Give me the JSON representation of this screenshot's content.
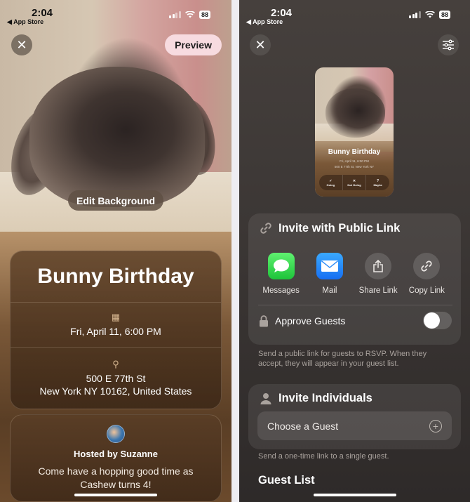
{
  "status_bar": {
    "time": "2:04",
    "back_app": "◀ App Store",
    "battery": "88"
  },
  "editor": {
    "close_icon": "✕",
    "preview_label": "Preview",
    "edit_background_label": "Edit Background",
    "event": {
      "title": "Bunny Birthday",
      "calendar_icon": "▦",
      "date": "Fri, April 11, 6:00 PM",
      "location_icon": "⚲",
      "address_line1": "500 E 77th St",
      "address_line2": "New York NY 10162, United States"
    },
    "host": {
      "hosted_by": "Hosted by Suzanne",
      "description": "Come have a hopping good time as Cashew turns 4!"
    }
  },
  "invite": {
    "close_icon": "✕",
    "settings_icon": "☰",
    "preview_card": {
      "title": "Bunny Birthday",
      "date": "Fri, April 11, 6:00 PM",
      "address": "500 E 77th St, New York NY",
      "rsvp": [
        {
          "icon": "✓",
          "label": "Going"
        },
        {
          "icon": "✕",
          "label": "Not Going"
        },
        {
          "icon": "?",
          "label": "Maybe"
        }
      ]
    },
    "public_link": {
      "title": "Invite with Public Link",
      "link_icon": "🔗",
      "share_options": [
        {
          "label": "Messages",
          "icon": "messages-icon"
        },
        {
          "label": "Mail",
          "icon": "mail-icon"
        },
        {
          "label": "Share Link",
          "icon": "share-icon"
        },
        {
          "label": "Copy Link",
          "icon": "link-icon"
        }
      ],
      "approve_guests_label": "Approve Guests",
      "approve_guests_on": false,
      "footnote": "Send a public link for guests to RSVP. When they accept, they will appear in your guest list."
    },
    "individuals": {
      "title": "Invite Individuals",
      "choose_label": "Choose a Guest",
      "plus_icon": "+",
      "footnote": "Send a one-time link to a single guest."
    },
    "guest_list_title": "Guest List"
  }
}
